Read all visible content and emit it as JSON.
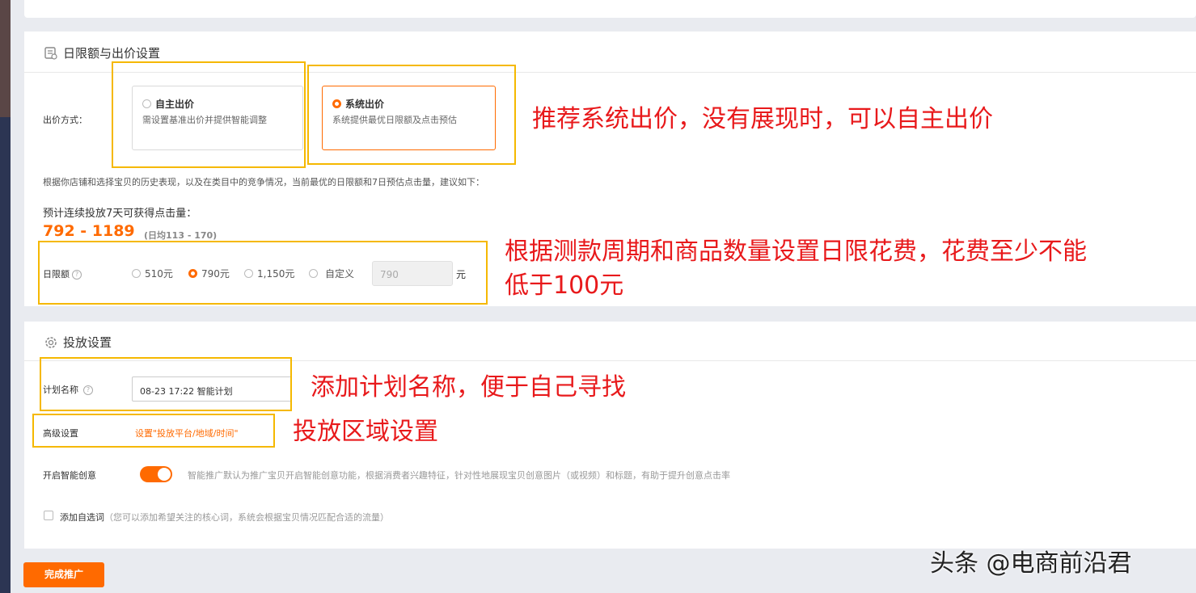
{
  "sections": {
    "budget": {
      "title": "日限额与出价设置"
    },
    "delivery": {
      "title": "投放设置"
    }
  },
  "bid": {
    "label": "出价方式：",
    "options": [
      {
        "title": "自主出价",
        "desc": "需设置基准出价并提供智能调整",
        "selected": false
      },
      {
        "title": "系统出价",
        "desc": "系统提供最优日限额及点击预估",
        "selected": true
      }
    ]
  },
  "recommend_text": "根据你店铺和选择宝贝的历史表现，以及在类目中的竞争情况，当前最优的日限额和7日预估点击量，建议如下：",
  "forecast": {
    "label": "预计连续投放7天可获得点击量：",
    "range": "792 - 1189",
    "daily": "(日均113 - 170)"
  },
  "daily_limit": {
    "label": "日限额",
    "options": [
      "510元",
      "790元",
      "1,150元",
      "自定义"
    ],
    "selected": "790元",
    "custom_value": "790",
    "unit": "元"
  },
  "plan": {
    "label": "计划名称",
    "value": "08-23 17:22 智能计划"
  },
  "advanced": {
    "label": "高级设置",
    "link": "设置\"投放平台/地域/时间\""
  },
  "smart_creative": {
    "label": "开启智能创意",
    "enabled": true,
    "desc": "智能推广默认为推广宝贝开启智能创意功能，根据消费者兴趣特征，针对性地展现宝贝创意图片（或视频）和标题，有助于提升创意点击率"
  },
  "custom_words": {
    "label": "添加自选词",
    "desc": "（您可以添加希望关注的核心词，系统会根据宝贝情况匹配合适的流量）",
    "checked": false
  },
  "done_button": "完成推广",
  "annotations": {
    "a1": "推荐系统出价，没有展现时，可以自主出价",
    "a2_line1": "根据测款周期和商品数量设置日限花费，花费至少不能",
    "a2_line2": "低于100元",
    "a3": "添加计划名称，便于自己寻找",
    "a4": "投放区域设置"
  },
  "watermark": "头条 @电商前沿君",
  "colors": {
    "accent": "#ff6a00",
    "annotation": "#e8191b",
    "highlight_box": "#f5b800"
  }
}
